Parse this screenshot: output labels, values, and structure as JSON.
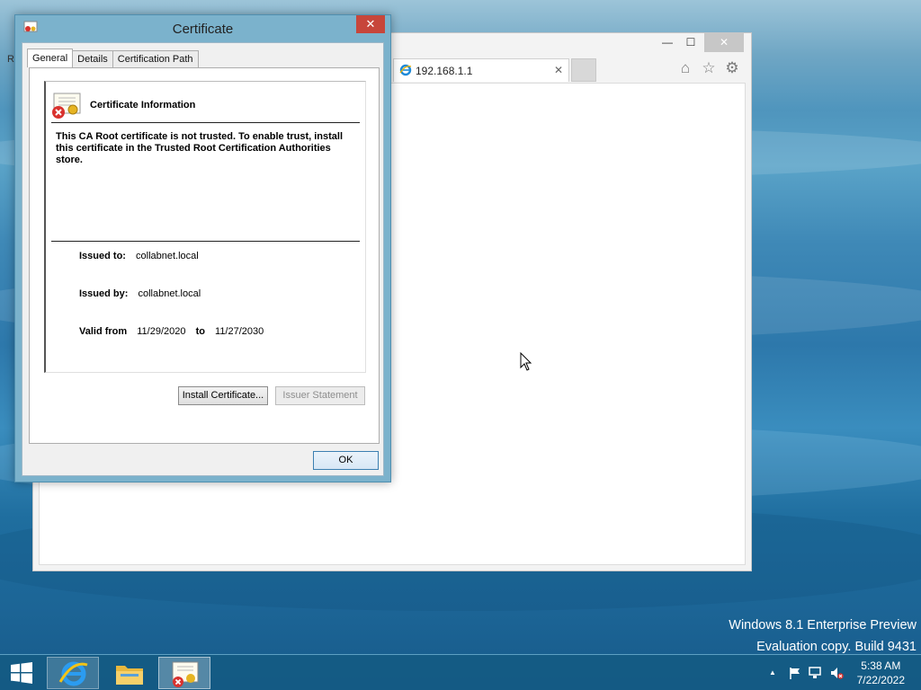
{
  "browser": {
    "tab_title": "192.168.1.1",
    "tab_close": "✕",
    "window_close": "✕",
    "window_max": "☐",
    "window_min": "—",
    "url_fragment": "R",
    "toolbar_icons": [
      "home-icon",
      "favorites-star-icon",
      "settings-gear-icon"
    ]
  },
  "dialog": {
    "title": "Certificate",
    "close": "✕",
    "tabs": [
      "General",
      "Details",
      "Certification Path"
    ],
    "active_tab": "General",
    "heading": "Certificate Information",
    "warning": "This CA Root certificate is not trusted. To enable trust, install this certificate in the Trusted Root Certification Authorities store.",
    "issued_to_label": "Issued to:",
    "issued_to": "collabnet.local",
    "issued_by_label": "Issued by:",
    "issued_by": "collabnet.local",
    "valid_from_label": "Valid from",
    "valid_from": "11/29/2020",
    "valid_to_label": "to",
    "valid_to": "11/27/2030",
    "install_button": "Install Certificate...",
    "issuer_button": "Issuer Statement",
    "ok_button": "OK"
  },
  "watermark": {
    "line1": "Windows 8.1 Enterprise Preview",
    "line2": "Evaluation copy. Build 9431"
  },
  "taskbar": {
    "items": [
      "internet-explorer",
      "file-explorer",
      "certificate"
    ],
    "tray_chevron": "▲",
    "time": "5:38 AM",
    "date": "7/22/2022"
  }
}
